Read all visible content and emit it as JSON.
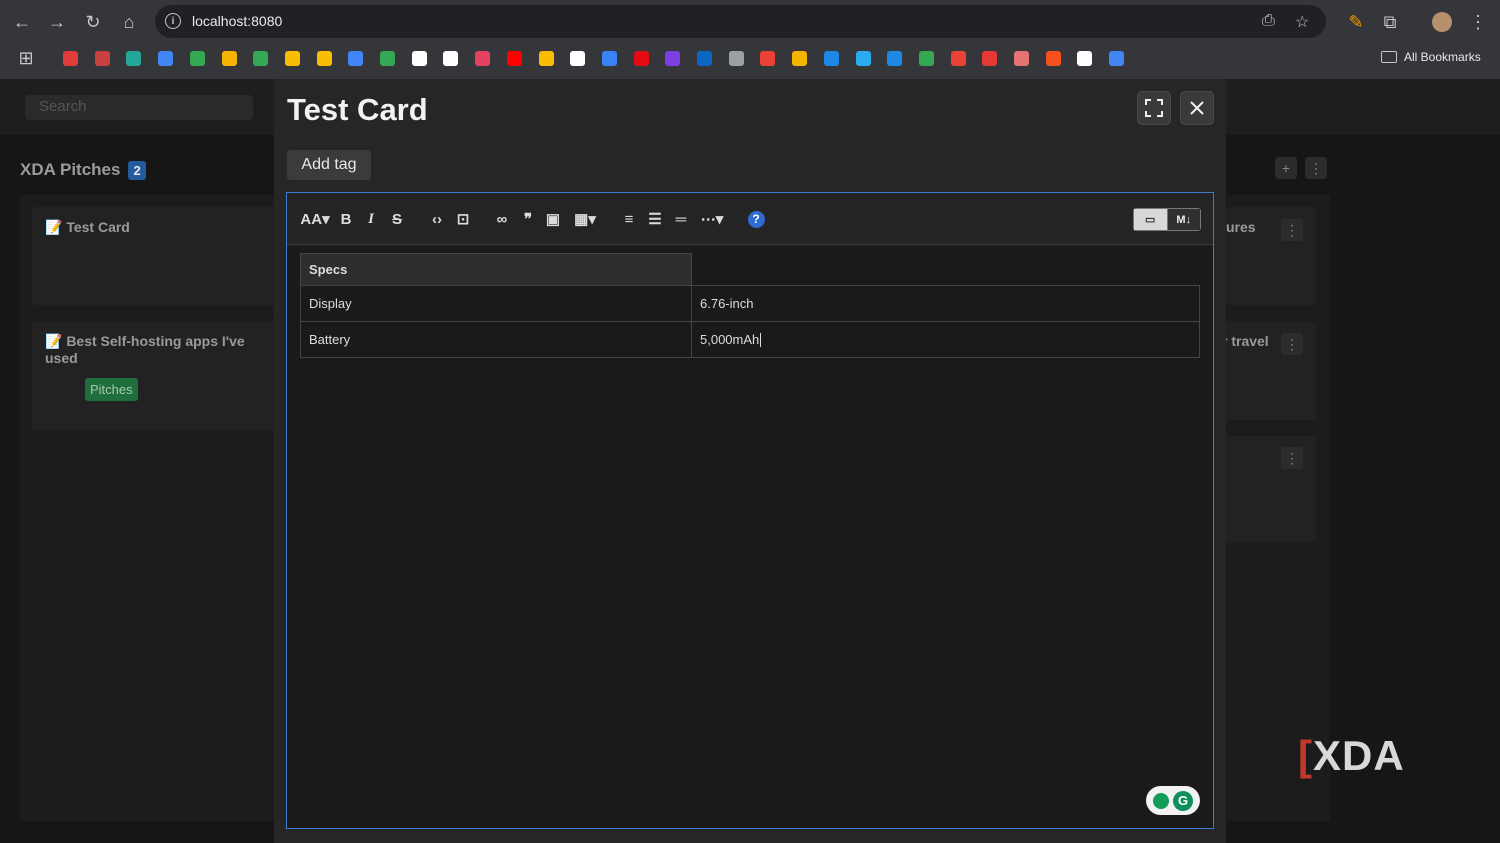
{
  "browser": {
    "url": "localhost:8080",
    "all_bookmarks_label": "All Bookmarks",
    "bookmark_colors": [
      "#e23b3b",
      "#c94040",
      "#26a69a",
      "#4285f4",
      "#34a853",
      "#f4b400",
      "#34a853",
      "#fbbc04",
      "#fbbc04",
      "#4285f4",
      "#34a853",
      "#ffffff",
      "#ffffff",
      "#e4405f",
      "#ff0000",
      "#fbbc04",
      "#ffffff",
      "#3b82f6",
      "#e50914",
      "#7b3fe4",
      "#0a66c2",
      "#9aa0a6",
      "#ea4335",
      "#f4b400",
      "#1e88e5",
      "#2aabee",
      "#1e88e5",
      "#34a853",
      "#ea4335",
      "#e53935",
      "#e57373",
      "#f4511e",
      "#ffffff",
      "#4285f4"
    ]
  },
  "background_board": {
    "search_placeholder": "Search",
    "column_title": "XDA Pitches",
    "column_count": "2",
    "cards": [
      {
        "title": "📝 Test Card"
      },
      {
        "title": "📝 Best Self-hosting apps I've used",
        "tag": "Pitches"
      }
    ],
    "right_fragments": [
      "ures",
      "r travel"
    ]
  },
  "modal": {
    "title": "Test Card",
    "add_tag_label": "Add tag",
    "table": {
      "header": "Specs",
      "rows": [
        {
          "label": "Display",
          "value": "6.76-inch"
        },
        {
          "label": "Battery",
          "value": "5,000mAh"
        }
      ]
    },
    "toolbar": {
      "font_size_label": "AA",
      "bold_label": "B",
      "italic_label": "I",
      "strike_label": "S",
      "markdown_label": "M↓"
    }
  },
  "watermark_text": "XDA",
  "colors": {
    "accent_blue": "#3b7bd1",
    "tag_green": "#1f6f3c",
    "badge_blue": "#245b9e"
  }
}
